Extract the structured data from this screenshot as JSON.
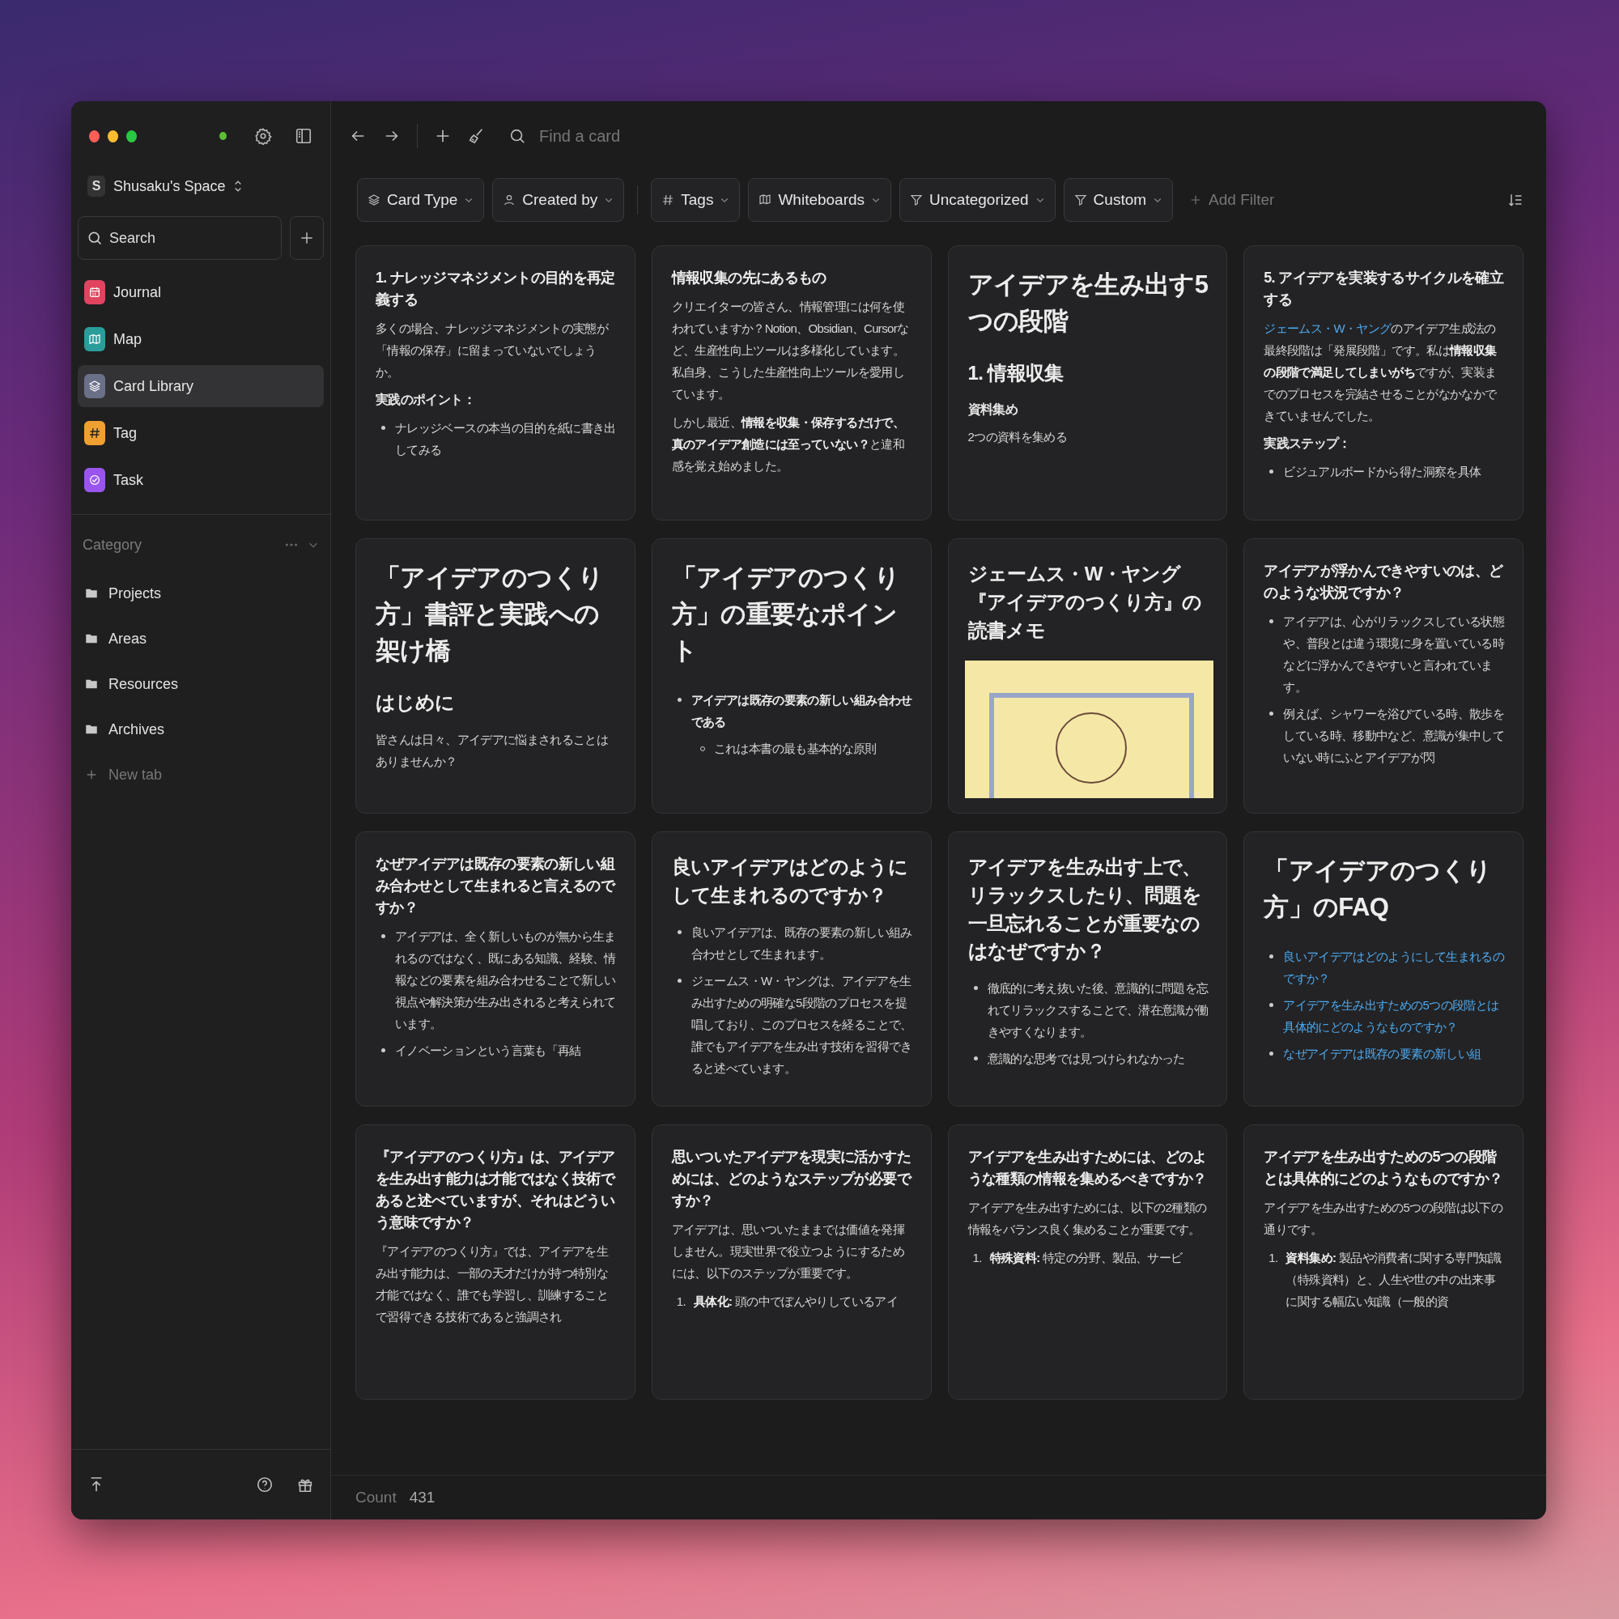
{
  "toolbar": {
    "search": {
      "placeholder": "Find a card"
    }
  },
  "workspace": {
    "initial": "S",
    "name": "Shusaku's Space"
  },
  "sidebar": {
    "search": "Search",
    "items": [
      {
        "label": "Journal",
        "kind": "calendar",
        "color": "#e0445f",
        "selected": false
      },
      {
        "label": "Map",
        "kind": "map",
        "color": "#2a9d9a",
        "selected": false
      },
      {
        "label": "Card Library",
        "kind": "layers",
        "color": "#6b7089",
        "selected": true
      },
      {
        "label": "Tag",
        "kind": "hash",
        "color": "#f0a030",
        "selected": false
      },
      {
        "label": "Task",
        "kind": "check",
        "color": "#9a55ee",
        "selected": false
      }
    ],
    "category": {
      "title": "Category",
      "folders": [
        "Projects",
        "Areas",
        "Resources",
        "Archives"
      ],
      "new_tab": "New tab"
    }
  },
  "filters": [
    {
      "kind": "layers",
      "label": "Card Type",
      "divider_before": false
    },
    {
      "kind": "person",
      "label": "Created by",
      "divider_before": false
    },
    {
      "kind": "hash",
      "label": "Tags",
      "divider_before": true
    },
    {
      "kind": "book",
      "label": "Whiteboards",
      "divider_before": false
    },
    {
      "kind": "filter",
      "label": "Uncategorized",
      "divider_before": false
    },
    {
      "kind": "filter",
      "label": "Custom",
      "divider_before": false
    }
  ],
  "add_filter": "Add Filter",
  "cards": [
    {
      "blocks": [
        {
          "kind": "h3",
          "text": "1. ナレッジマネジメントの目的を再定義する"
        },
        {
          "kind": "p",
          "text": "多くの場合、ナレッジマネジメントの実態が「情報の保存」に留まっていないでしょうか。"
        },
        {
          "kind": "label",
          "text": "実践のポイント："
        },
        {
          "kind": "bullets",
          "items": [
            {
              "text": "ナレッジベースの本当の目的を紙に書き出してみる"
            }
          ]
        }
      ]
    },
    {
      "blocks": [
        {
          "kind": "h3",
          "text": "情報収集の先にあるもの"
        },
        {
          "kind": "p",
          "text": "クリエイターの皆さん、情報管理には何を使われていますか？Notion、Obsidian、Cursorなど、生産性向上ツールは多様化しています。私自身、こうした生産性向上ツールを愛用しています。"
        },
        {
          "kind": "p",
          "text": "しかし最近、**情報を収集・保存するだけで、真のアイデア創造には至っていない？**と違和感を覚え始めました。"
        }
      ]
    },
    {
      "blocks": [
        {
          "kind": "h1",
          "text": "アイデアを生み出す5つの段階"
        },
        {
          "kind": "h2",
          "text": "1. 情報収集"
        },
        {
          "kind": "label",
          "text": "資料集め"
        },
        {
          "kind": "p",
          "text": "2つの資料を集める"
        }
      ]
    },
    {
      "blocks": [
        {
          "kind": "h3",
          "text": "5. アイデアを実装するサイクルを確立する"
        },
        {
          "kind": "p",
          "link": "ジェームス・W・ヤング",
          "text": "のアイデア生成法の最終段階は「発展段階」です。私は**情報収集の段階で満足してしまいがち**ですが、実装までのプロセスを完結させることがなかなかできていませんでした。"
        },
        {
          "kind": "label",
          "text": "実践ステップ："
        },
        {
          "kind": "bullets",
          "items": [
            {
              "text": "ビジュアルボードから得た洞察を具体"
            }
          ]
        }
      ]
    },
    {
      "blocks": [
        {
          "kind": "h1",
          "text": "「アイデアのつくり方」書評と実践への架け橋"
        },
        {
          "kind": "h2",
          "text": "はじめに"
        },
        {
          "kind": "p",
          "text": "皆さんは日々、アイデアに悩まされることはありませんか？"
        }
      ]
    },
    {
      "blocks": [
        {
          "kind": "h1",
          "text": "「アイデアのつくり方」の重要なポイント"
        },
        {
          "kind": "bullets",
          "items": [
            {
              "text": "アイデアは既存の要素の新しい組み合わせである",
              "bold": true,
              "children": [
                {
                  "text": "これは本書の最も基本的な原則"
                }
              ]
            }
          ]
        }
      ]
    },
    {
      "blocks": [
        {
          "kind": "h2",
          "text": "ジェームス・W・ヤング『アイデアのつくり方』の読書メモ"
        },
        {
          "kind": "image"
        }
      ]
    },
    {
      "blocks": [
        {
          "kind": "h3",
          "text": "アイデアが浮かんできやすいのは、どのような状況ですか？"
        },
        {
          "kind": "bullets",
          "items": [
            {
              "text": "アイデアは、心がリラックスしている状態や、普段とは違う環境に身を置いている時などに浮かんできやすいと言われています。"
            },
            {
              "text": "例えば、シャワーを浴びている時、散歩をしている時、移動中など、意識が集中していない時にふとアイデアが閃"
            }
          ]
        }
      ]
    },
    {
      "blocks": [
        {
          "kind": "h3",
          "text": "なぜアイデアは既存の要素の新しい組み合わせとして生まれると言えるのですか？"
        },
        {
          "kind": "bullets",
          "items": [
            {
              "text": "アイデアは、全く新しいものが無から生まれるのではなく、既にある知識、経験、情報などの要素を組み合わせることで新しい視点や解決策が生み出されると考えられています。"
            },
            {
              "text": "イノベーションという言葉も「再結"
            }
          ]
        }
      ]
    },
    {
      "blocks": [
        {
          "kind": "h2",
          "text": "良いアイデアはどのようにして生まれるのですか？"
        },
        {
          "kind": "bullets",
          "items": [
            {
              "text": "良いアイデアは、既存の要素の新しい組み合わせとして生まれます。"
            },
            {
              "text": "ジェームス・W・ヤングは、アイデアを生み出すための明確な5段階のプロセスを提唱しており、このプロセスを経ることで、誰でもアイデアを生み出す技術を習得できると述べています。"
            }
          ]
        }
      ]
    },
    {
      "blocks": [
        {
          "kind": "h2",
          "text": "アイデアを生み出す上で、リラックスしたり、問題を一旦忘れることが重要なのはなぜですか？"
        },
        {
          "kind": "bullets",
          "items": [
            {
              "text": "徹底的に考え抜いた後、意識的に問題を忘れてリラックスすることで、潜在意識が働きやすくなります。"
            },
            {
              "text": "意識的な思考では見つけられなかった"
            }
          ]
        }
      ]
    },
    {
      "blocks": [
        {
          "kind": "h1",
          "text": "「アイデアのつくり方」のFAQ"
        },
        {
          "kind": "links",
          "items": [
            "良いアイデアはどのようにして生まれるのですか？",
            "アイデアを生み出すための5つの段階とは具体的にどのようなものですか？",
            "なぜアイデアは既存の要素の新しい組"
          ]
        }
      ]
    },
    {
      "blocks": [
        {
          "kind": "h3",
          "text": "『アイデアのつくり方』は、アイデアを生み出す能力は才能ではなく技術であると述べていますが、それはどういう意味ですか？"
        },
        {
          "kind": "p",
          "text": "『アイデアのつくり方』では、アイデアを生み出す能力は、一部の天才だけが持つ特別な才能ではなく、誰でも学習し、訓練することで習得できる技術であると強調され"
        }
      ]
    },
    {
      "blocks": [
        {
          "kind": "h3",
          "text": "思いついたアイデアを現実に活かすためには、どのようなステップが必要ですか？"
        },
        {
          "kind": "p",
          "text": "アイデアは、思いついたままでは価値を発揮しません。現実世界で役立つようにするためには、以下のステップが重要です。"
        },
        {
          "kind": "numbered",
          "items": [
            {
              "number": "1.",
              "text": "**具体化:** 頭の中でぼんやりしているアイ"
            }
          ]
        }
      ]
    },
    {
      "blocks": [
        {
          "kind": "h3",
          "text": "アイデアを生み出すためには、どのような種類の情報を集めるべきですか？"
        },
        {
          "kind": "p",
          "text": "アイデアを生み出すためには、以下の2種類の情報をバランス良く集めることが重要です。"
        },
        {
          "kind": "numbered",
          "items": [
            {
              "number": "1.",
              "text": "**特殊資料:** 特定の分野、製品、サービ"
            }
          ]
        }
      ]
    },
    {
      "blocks": [
        {
          "kind": "h3",
          "text": "アイデアを生み出すための5つの段階とは具体的にどのようなものですか？"
        },
        {
          "kind": "p",
          "text": "アイデアを生み出すための5つの段階は以下の通りです。"
        },
        {
          "kind": "numbered",
          "items": [
            {
              "number": "1.",
              "text": "**資料集め:** 製品や消費者に関する専門知識（特殊資料）と、人生や世の中の出来事に関する幅広い知識（一般的資"
            }
          ]
        }
      ]
    }
  ],
  "status_bar": {
    "label": "Count",
    "value": "431"
  }
}
